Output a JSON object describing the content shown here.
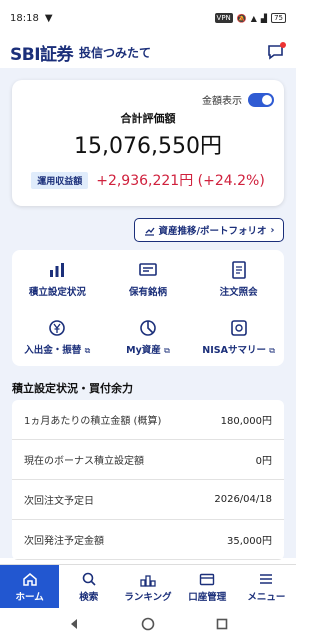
{
  "status_bar": {
    "time": "18:18",
    "vpn": "VPN",
    "battery": "75"
  },
  "app_bar": {
    "logo": "SBI証券",
    "subtitle": "投信つみたて"
  },
  "evaluation": {
    "toggle_label": "金額表示",
    "label": "合計評価額",
    "value": "15,076,550円",
    "gain_badge": "運用収益額",
    "gain_value": "+2,936,221円 (+24.2%)"
  },
  "portfolio_button": {
    "label": "資産推移/ポートフォリオ"
  },
  "menu": {
    "items": [
      {
        "label": "積立設定状況",
        "icon": "bar-chart-icon"
      },
      {
        "label": "保有銘柄",
        "icon": "card-list-icon"
      },
      {
        "label": "注文照会",
        "icon": "document-icon"
      },
      {
        "label": "入出金・振替",
        "icon": "yen-exchange-icon"
      },
      {
        "label": "My資産",
        "icon": "pie-chart-icon"
      },
      {
        "label": "NISAサマリー",
        "icon": "nisa-icon"
      }
    ]
  },
  "settings": {
    "title": "積立設定状況・買付余力",
    "rows": [
      {
        "label": "1ヵ月あたりの積立金額 (概算)",
        "value": "180,000円"
      },
      {
        "label": "現在のボーナス積立設定額",
        "value": "0円"
      },
      {
        "label": "次回注文予定日",
        "value": "2026/04/18"
      },
      {
        "label": "次回発注予定金額",
        "value": "35,000円"
      }
    ]
  },
  "bottom_nav": {
    "items": [
      {
        "label": "ホーム",
        "icon": "home-icon"
      },
      {
        "label": "検索",
        "icon": "search-icon"
      },
      {
        "label": "ランキング",
        "icon": "ranking-icon"
      },
      {
        "label": "口座管理",
        "icon": "wallet-icon"
      },
      {
        "label": "メニュー",
        "icon": "menu-icon"
      }
    ]
  },
  "colors": {
    "brand": "#1b2f7a",
    "accent": "#2257d0",
    "gain": "#d0213d"
  }
}
